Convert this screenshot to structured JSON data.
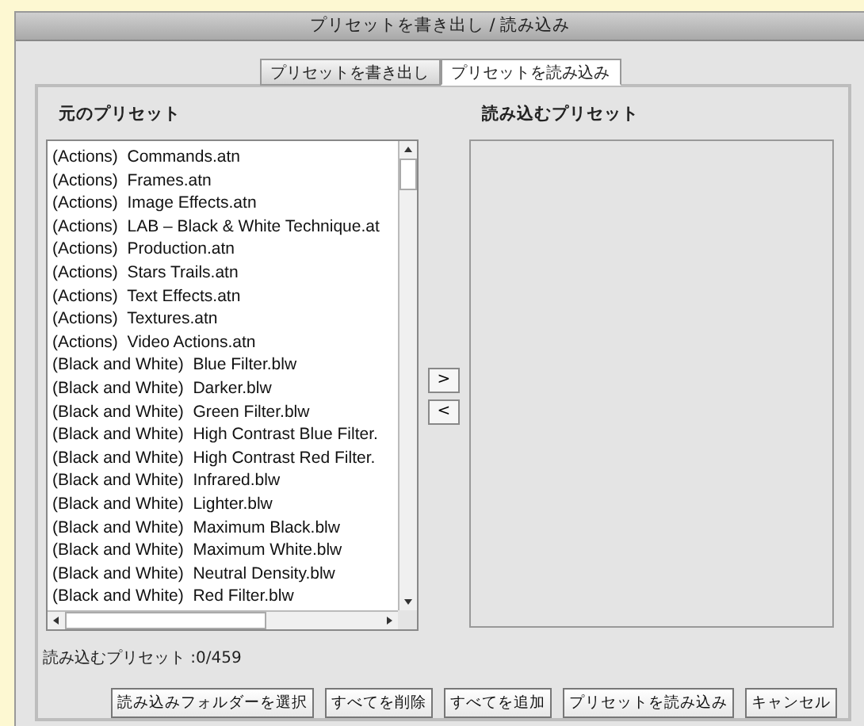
{
  "window": {
    "title": "プリセットを書き出し / 読み込み"
  },
  "tabs": [
    {
      "label": "プリセットを書き出し",
      "selected": false
    },
    {
      "label": "プリセットを読み込み",
      "selected": true
    }
  ],
  "source_list": {
    "label": "元のプリセット",
    "items": [
      {
        "text": "(Actions)  Commands.atn",
        "selected": false
      },
      {
        "text": "(Actions)  Frames.atn",
        "selected": false
      },
      {
        "text": "(Actions)  Image Effects.atn",
        "selected": false
      },
      {
        "text": "(Actions)  LAB – Black & White Technique.at",
        "selected": false
      },
      {
        "text": "(Actions)  Production.atn",
        "selected": false
      },
      {
        "text": "(Actions)  Stars Trails.atn",
        "selected": false
      },
      {
        "text": "(Actions)  Text Effects.atn",
        "selected": false
      },
      {
        "text": "(Actions)  Textures.atn",
        "selected": false
      },
      {
        "text": "(Actions)  Video Actions.atn",
        "selected": false
      },
      {
        "text": "(Black and White)  Blue Filter.blw",
        "selected": false
      },
      {
        "text": "(Black and White)  Darker.blw",
        "selected": false
      },
      {
        "text": "(Black and White)  Green Filter.blw",
        "selected": false
      },
      {
        "text": "(Black and White)  High Contrast Blue Filter.",
        "selected": false
      },
      {
        "text": "(Black and White)  High Contrast Red Filter.",
        "selected": false
      },
      {
        "text": "(Black and White)  Infrared.blw",
        "selected": false
      },
      {
        "text": "(Black and White)  Lighter.blw",
        "selected": false
      },
      {
        "text": "(Black and White)  Maximum Black.blw",
        "selected": false
      },
      {
        "text": "(Black and White)  Maximum White.blw",
        "selected": false
      },
      {
        "text": "(Black and White)  Neutral Density.blw",
        "selected": false
      },
      {
        "text": "(Black and White)  Red Filter.blw",
        "selected": false
      }
    ]
  },
  "move_buttons": [
    ">",
    "<"
  ],
  "target_list": {
    "label": "読み込むプリセット"
  },
  "count": "読み込むプリセット :0/459",
  "buttons": [
    "読み込みフォルダーを選択",
    "すべてを削除",
    "すべてを追加",
    "プリセットを読み込み",
    "キャンセル"
  ]
}
